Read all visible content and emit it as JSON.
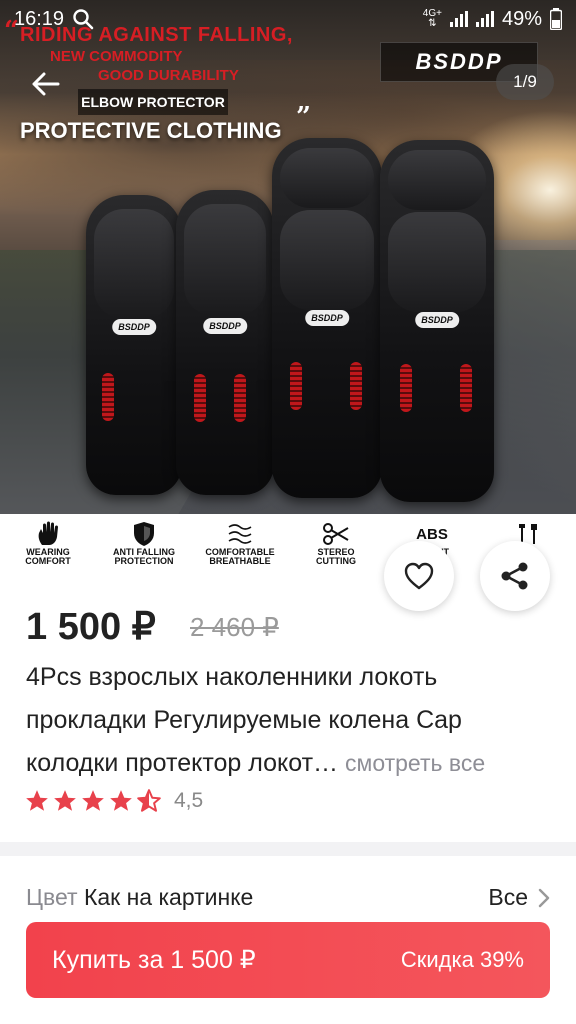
{
  "status_bar": {
    "time": "16:19",
    "network": "4G+",
    "battery": "49%"
  },
  "gallery": {
    "counter": "1/9",
    "brand": "BSDDP",
    "banner_line1": "RIDING AGAINST FALLING,",
    "banner_line2": "NEW COMMODITY",
    "banner_line3": "GOOD DURABILITY",
    "banner_tag": "ELBOW PROTECTOR",
    "banner_title": "PROTECTIVE CLOTHING",
    "pad_logo": "BSDDP"
  },
  "features": [
    {
      "icon": "hand-icon",
      "label_1": "WEARING",
      "label_2": "COMFORT"
    },
    {
      "icon": "shield-icon",
      "label_1": "ANTI FALLING",
      "label_2": "PROTECTION"
    },
    {
      "icon": "wind-icon",
      "label_1": "COMFORTABLE",
      "label_2": "BREATHABLE"
    },
    {
      "icon": "scissors-icon",
      "label_1": "STEREO",
      "label_2": "CUTTING"
    },
    {
      "icon": "abs-icon",
      "label_1": "W...ANT",
      "label_2": "",
      "icon_text": "ABS"
    },
    {
      "icon": "tools-icon",
      "label_1": "",
      "label_2": ""
    }
  ],
  "product": {
    "price": "1 500 ₽",
    "old_price": "2 460 ₽",
    "title": "4Pcs взрослых наколенники локоть прокладки Регулируемые колена Cap колодки протектор локот…",
    "see_all": "смотреть все",
    "rating": "4,5"
  },
  "options": {
    "color_label": "Цвет",
    "color_value": "Как на картинке",
    "all_label": "Все"
  },
  "buy": {
    "label": "Купить за 1 500 ₽",
    "discount": "Скидка 39%"
  },
  "colors": {
    "accent": "#f2424c",
    "star": "#e8414b"
  }
}
